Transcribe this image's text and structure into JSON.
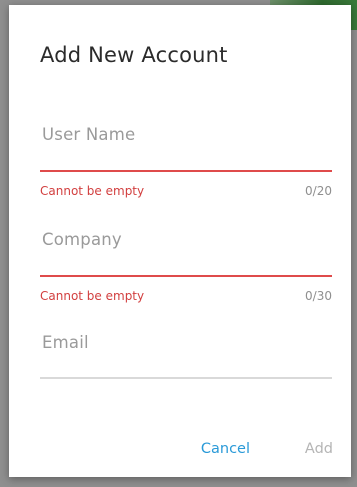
{
  "dialog": {
    "title": "Add New Account",
    "fields": {
      "user_name": {
        "placeholder": "User Name",
        "error": "Cannot be empty",
        "counter": "0/20"
      },
      "company": {
        "placeholder": "Company",
        "error": "Cannot be empty",
        "counter": "0/30"
      },
      "email": {
        "placeholder": "Email"
      }
    },
    "buttons": {
      "cancel": "Cancel",
      "add": "Add"
    }
  },
  "colors": {
    "error": "#df4b4b",
    "accent": "#2a9ad8",
    "disabled": "#b5b5b5"
  }
}
